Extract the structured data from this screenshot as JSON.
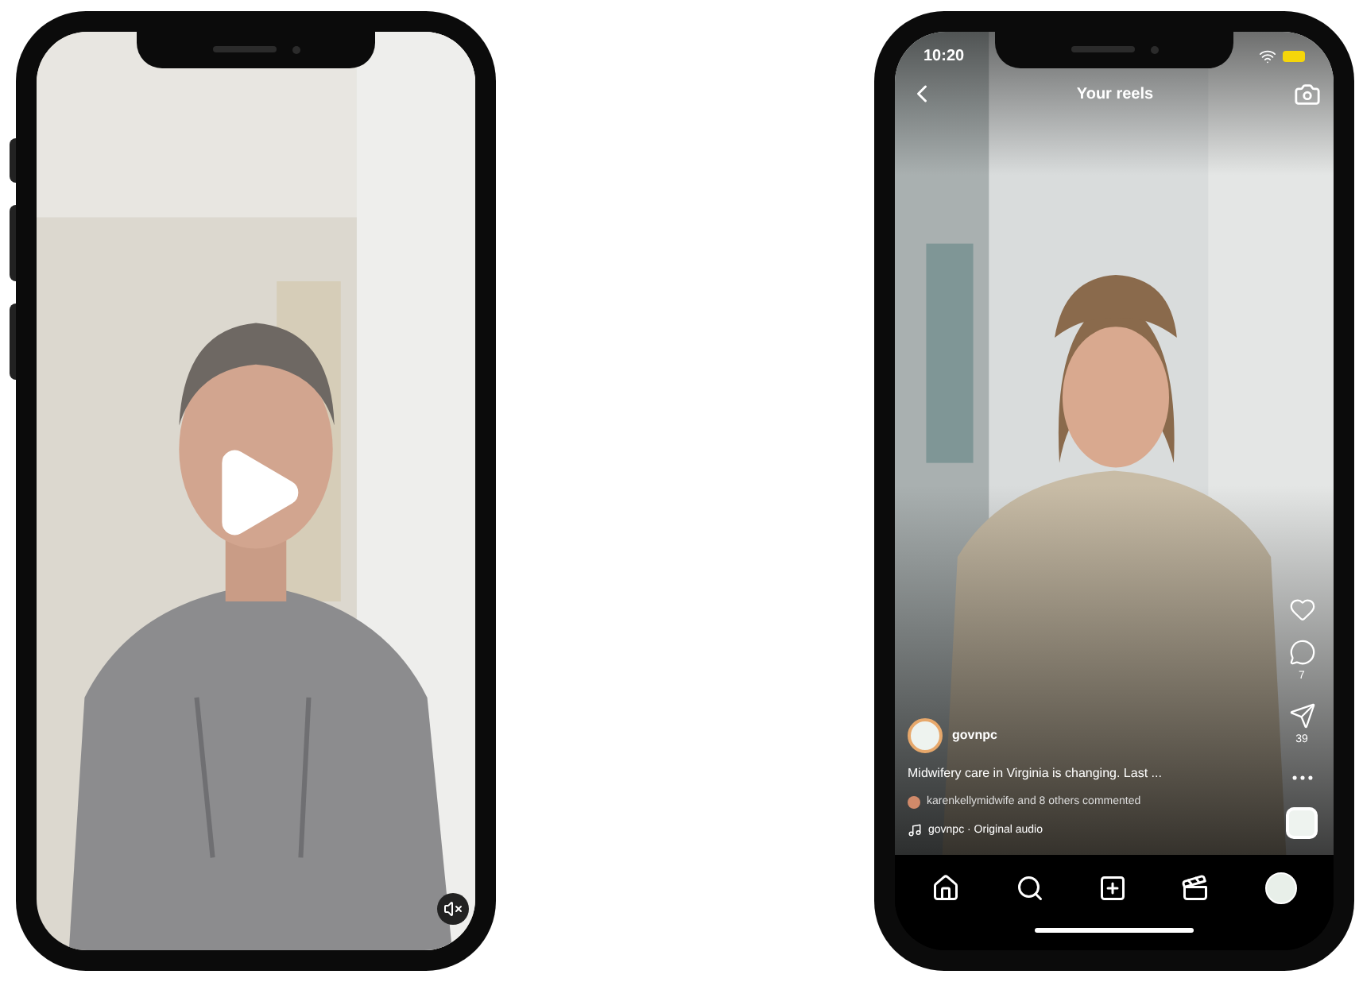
{
  "phones": [
    {
      "kind": "video_player"
    },
    {
      "kind": "reels",
      "status_time": "10:20",
      "header_title": "Your reels",
      "actions": [
        {
          "kind": "like"
        },
        {
          "kind": "comment",
          "count": "7"
        },
        {
          "kind": "share",
          "count": "39"
        },
        {
          "kind": "more"
        }
      ],
      "username": "govnpc",
      "caption": "Midwifery care in Virginia is changing. Last ...",
      "comments_line": "karenkellymidwife and 8 others commented",
      "audio": "govnpc · Original audio",
      "nav": [
        {
          "kind": "home"
        },
        {
          "kind": "search"
        },
        {
          "kind": "create"
        },
        {
          "kind": "reels"
        },
        {
          "kind": "profile"
        }
      ]
    }
  ]
}
